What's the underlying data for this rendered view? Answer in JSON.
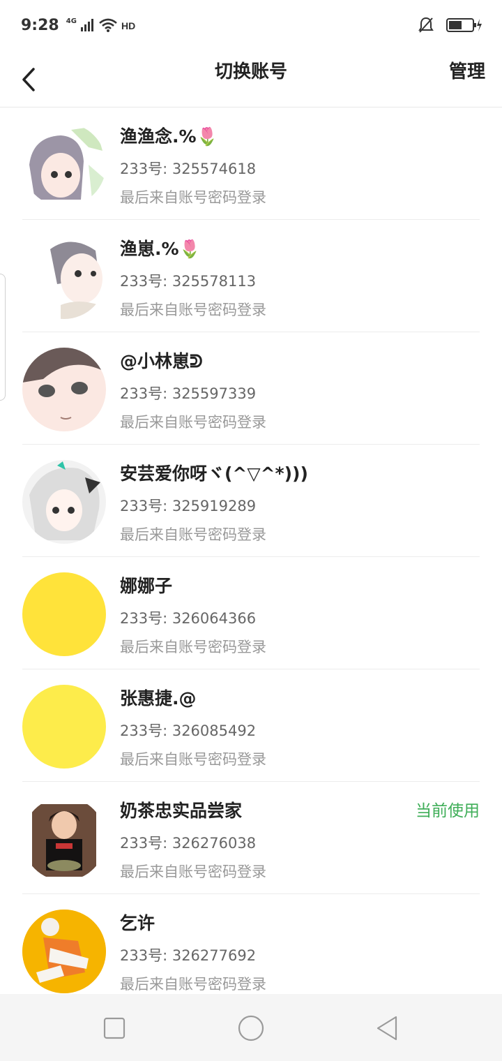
{
  "status_bar": {
    "time": "9:28",
    "network": "4G",
    "icons": [
      "signal-icon",
      "wifi-icon",
      "hd-icon",
      "mute-bell-icon",
      "battery-icon",
      "charging-icon"
    ]
  },
  "nav": {
    "title": "切换账号",
    "manage_label": "管理",
    "back_icon": "chevron-left-icon"
  },
  "accounts": [
    {
      "name": "渔渔念.%🌷",
      "uid": "233号: 325574618",
      "login": "最后来自账号密码登录",
      "current": "",
      "avatar": "anime-avatar"
    },
    {
      "name": "渔崽.%🌷",
      "uid": "233号: 325578113",
      "login": "最后来自账号密码登录",
      "current": "",
      "avatar": "anime-avatar"
    },
    {
      "name": "@小林崽ᕲ",
      "uid": "233号: 325597339",
      "login": "最后来自账号密码登录",
      "current": "",
      "avatar": "anime-avatar"
    },
    {
      "name": "安芸爱你呀ヾ(^▽^*)))",
      "uid": "233号: 325919289",
      "login": "最后来自账号密码登录",
      "current": "",
      "avatar": "anime-avatar"
    },
    {
      "name": "娜娜子",
      "uid": "233号: 326064366",
      "login": "最后来自账号密码登录",
      "current": "",
      "avatar": "yellow-avatar"
    },
    {
      "name": "张惠捷.@",
      "uid": "233号: 326085492",
      "login": "最后来自账号密码登录",
      "current": "",
      "avatar": "yellow-avatar"
    },
    {
      "name": "奶茶忠实品尝家",
      "uid": "233号: 326276038",
      "login": "最后来自账号密码登录",
      "current": "当前使用",
      "avatar": "photo-avatar"
    },
    {
      "name": "乞许",
      "uid": "233号: 326277692",
      "login": "最后来自账号密码登录",
      "current": "",
      "avatar": "orange-avatar"
    }
  ],
  "colors": {
    "current_accent": "#3fae58",
    "yellow_avatar": "#ffe33a",
    "orange_avatar": "#f6b400"
  },
  "bottom_nav": {
    "icons": [
      "recent-apps-icon",
      "home-icon",
      "back-triangle-icon"
    ]
  }
}
